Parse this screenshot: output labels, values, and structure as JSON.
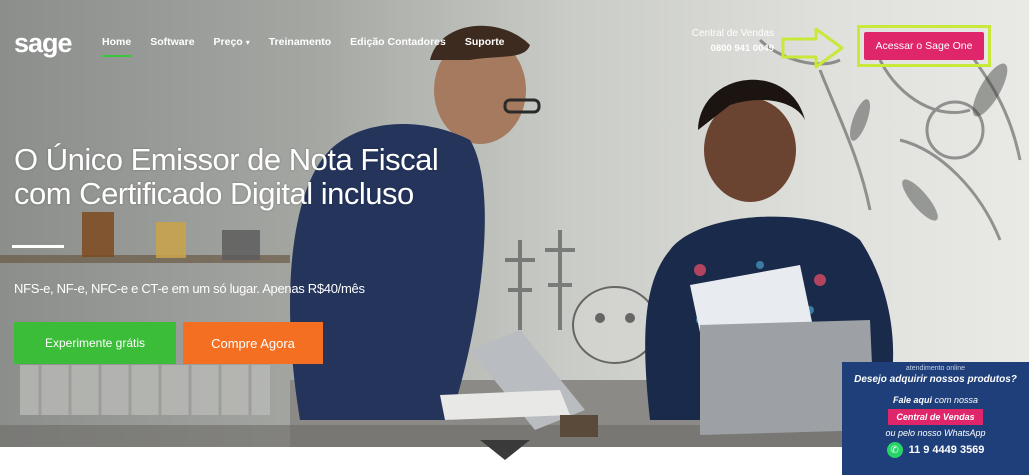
{
  "brand": {
    "logo": "sage"
  },
  "nav": {
    "items": [
      {
        "label": "Home",
        "active": true
      },
      {
        "label": "Software"
      },
      {
        "label": "Preço",
        "caret": "▾"
      },
      {
        "label": "Treinamento"
      },
      {
        "label": "Edição Contadores"
      },
      {
        "label": "Suporte"
      }
    ]
  },
  "sales": {
    "title": "Central de Vendas",
    "phone": "0800 941 0049"
  },
  "login": {
    "label": "Acessar o Sage One"
  },
  "hero": {
    "headline_line1": "O Único Emissor de Nota Fiscal",
    "headline_line2": "com Certificado Digital incluso",
    "subline": "NFS-e, NF-e, NFC-e e CT-e em um só lugar. Apenas R$40/mês",
    "try_button": "Experimente grátis",
    "buy_button": "Compre Agora"
  },
  "chat": {
    "small": "atendimento online",
    "title": "Desejo adquirir nossos produtos?",
    "line1_bold": "Fale aqui",
    "line1_rest": " com nossa",
    "button": "Central de Vendas",
    "line2": "ou pelo nosso WhatsApp",
    "whatsapp": "11 9 4449 3569"
  },
  "colors": {
    "accent_green": "#3cbd3a",
    "accent_orange": "#f46f22",
    "accent_pink": "#e0266b",
    "highlight_border": "#c8e83a",
    "chat_bg": "#1e3f7a"
  }
}
